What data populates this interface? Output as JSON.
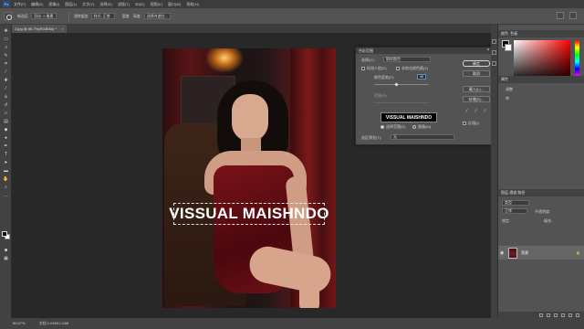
{
  "app": {
    "logo": "Ps"
  },
  "menubar": {
    "items": [
      "文件(F)",
      "编辑(E)",
      "图像(I)",
      "图层(L)",
      "文字(Y)",
      "选择(S)",
      "滤镜(T)",
      "3D(D)",
      "视图(V)",
      "窗口(W)",
      "帮助(H)"
    ]
  },
  "options_bar": {
    "label_1": "新选区",
    "select_1": "羽化: 0 像素",
    "label_2": "消除锯齿",
    "select_2": "样式: 正常",
    "label_3": "宽度:",
    "label_4": "高度:",
    "refine_label": "选择并遮住..."
  },
  "document_tab": {
    "title": "2.jpg @ 66.7%(RGB/8#) *",
    "close": "×"
  },
  "dialog": {
    "title": "色彩范围",
    "close": "×",
    "select_label": "选择(C):",
    "select_value": "取样颜色",
    "detect_faces_label": "检测人脸(D)",
    "localized_label": "本地化颜色簇(Z)",
    "fuzziness_label": "颜色容差(F):",
    "fuzziness_value": "40",
    "range_label": "范围(R):",
    "preview_text": "VISSUAL MAISHNDO",
    "radio_selection": "选择范围(E)",
    "radio_image": "图像(M)",
    "selection_preview_label": "选区预览(T):",
    "selection_preview_value": "无",
    "buttons": {
      "ok": "确定",
      "cancel": "取消",
      "load": "载入(L)...",
      "save": "存储(S)..."
    },
    "invert_label": "反相(I)",
    "fuzziness_level": 0.4
  },
  "canvas": {
    "watermark": "VISSUAL MAISHNDO"
  },
  "panels": {
    "color_tab": "颜色",
    "swatches_tab": "色板",
    "properties_tab": "属性",
    "adjustments_tab": "调整",
    "libraries_tab": "库",
    "layers_tabs": "图层  通道  路径",
    "kind_label": "类型",
    "blend_mode": "正常",
    "opacity_label": "不透明度:",
    "lock_label": "锁定:",
    "fill_label": "填充:",
    "layer_name": "背景",
    "layer_lock": "🔒"
  },
  "status": {
    "zoom": "66.67%",
    "doc": "文档:1.04M/1.04M"
  },
  "colors": {
    "foreground": "#000000",
    "background": "#ffffff",
    "accent": "#5a8ed0"
  }
}
